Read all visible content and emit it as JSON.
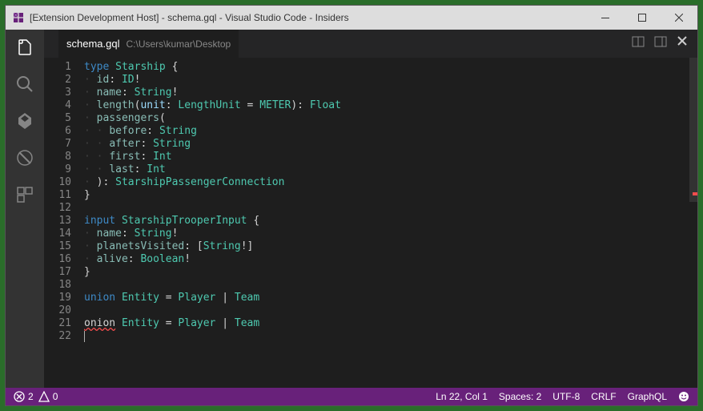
{
  "window": {
    "title": "[Extension Development Host] - schema.gql - Visual Studio Code - Insiders"
  },
  "tab": {
    "filename": "schema.gql",
    "filepath": "C:\\Users\\kumar\\Desktop"
  },
  "code": {
    "lines": [
      {
        "n": 1,
        "tokens": [
          {
            "t": "type",
            "c": "kw"
          },
          {
            "t": " "
          },
          {
            "t": "Starship",
            "c": "type"
          },
          {
            "t": " {",
            "c": "punct"
          }
        ]
      },
      {
        "n": 2,
        "indent": 1,
        "tokens": [
          {
            "t": "id",
            "c": "field"
          },
          {
            "t": ": ",
            "c": "punct"
          },
          {
            "t": "ID",
            "c": "type"
          },
          {
            "t": "!",
            "c": "punct"
          }
        ]
      },
      {
        "n": 3,
        "indent": 1,
        "tokens": [
          {
            "t": "name",
            "c": "field"
          },
          {
            "t": ": ",
            "c": "punct"
          },
          {
            "t": "String",
            "c": "type"
          },
          {
            "t": "!",
            "c": "punct"
          }
        ]
      },
      {
        "n": 4,
        "indent": 1,
        "tokens": [
          {
            "t": "length",
            "c": "field"
          },
          {
            "t": "(",
            "c": "punct"
          },
          {
            "t": "unit",
            "c": "param"
          },
          {
            "t": ": ",
            "c": "punct"
          },
          {
            "t": "LengthUnit",
            "c": "type"
          },
          {
            "t": " = ",
            "c": "punct"
          },
          {
            "t": "METER",
            "c": "type"
          },
          {
            "t": "): ",
            "c": "punct"
          },
          {
            "t": "Float",
            "c": "type"
          }
        ]
      },
      {
        "n": 5,
        "indent": 1,
        "tokens": [
          {
            "t": "passengers",
            "c": "field"
          },
          {
            "t": "(",
            "c": "punct"
          }
        ]
      },
      {
        "n": 6,
        "indent": 2,
        "tokens": [
          {
            "t": "before",
            "c": "field"
          },
          {
            "t": ": ",
            "c": "punct"
          },
          {
            "t": "String",
            "c": "type"
          }
        ]
      },
      {
        "n": 7,
        "indent": 2,
        "tokens": [
          {
            "t": "after",
            "c": "field"
          },
          {
            "t": ": ",
            "c": "punct"
          },
          {
            "t": "String",
            "c": "type"
          }
        ]
      },
      {
        "n": 8,
        "indent": 2,
        "tokens": [
          {
            "t": "first",
            "c": "field"
          },
          {
            "t": ": ",
            "c": "punct"
          },
          {
            "t": "Int",
            "c": "type"
          }
        ]
      },
      {
        "n": 9,
        "indent": 2,
        "tokens": [
          {
            "t": "last",
            "c": "field"
          },
          {
            "t": ": ",
            "c": "punct"
          },
          {
            "t": "Int",
            "c": "type"
          }
        ]
      },
      {
        "n": 10,
        "indent": 1,
        "tokens": [
          {
            "t": "): ",
            "c": "punct"
          },
          {
            "t": "StarshipPassengerConnection",
            "c": "type"
          }
        ]
      },
      {
        "n": 11,
        "tokens": [
          {
            "t": "}",
            "c": "punct"
          }
        ]
      },
      {
        "n": 12,
        "tokens": []
      },
      {
        "n": 13,
        "tokens": [
          {
            "t": "input",
            "c": "kw"
          },
          {
            "t": " "
          },
          {
            "t": "StarshipTrooperInput",
            "c": "type"
          },
          {
            "t": " {",
            "c": "punct"
          }
        ]
      },
      {
        "n": 14,
        "indent": 1,
        "tokens": [
          {
            "t": "name",
            "c": "field"
          },
          {
            "t": ": ",
            "c": "punct"
          },
          {
            "t": "String",
            "c": "type"
          },
          {
            "t": "!",
            "c": "punct"
          }
        ]
      },
      {
        "n": 15,
        "indent": 1,
        "tokens": [
          {
            "t": "planetsVisited",
            "c": "field"
          },
          {
            "t": ": [",
            "c": "punct"
          },
          {
            "t": "String",
            "c": "type"
          },
          {
            "t": "!]",
            "c": "punct"
          }
        ]
      },
      {
        "n": 16,
        "indent": 1,
        "tokens": [
          {
            "t": "alive",
            "c": "field"
          },
          {
            "t": ": ",
            "c": "punct"
          },
          {
            "t": "Boolean",
            "c": "type"
          },
          {
            "t": "!",
            "c": "punct"
          }
        ]
      },
      {
        "n": 17,
        "tokens": [
          {
            "t": "}",
            "c": "punct"
          }
        ]
      },
      {
        "n": 18,
        "tokens": []
      },
      {
        "n": 19,
        "tokens": [
          {
            "t": "union",
            "c": "kw"
          },
          {
            "t": " "
          },
          {
            "t": "Entity",
            "c": "type"
          },
          {
            "t": " = ",
            "c": "punct"
          },
          {
            "t": "Player",
            "c": "type"
          },
          {
            "t": " | ",
            "c": "punct"
          },
          {
            "t": "Team",
            "c": "type"
          }
        ]
      },
      {
        "n": 20,
        "tokens": []
      },
      {
        "n": 21,
        "tokens": [
          {
            "t": "onion",
            "c": "error"
          },
          {
            "t": " "
          },
          {
            "t": "Entity",
            "c": "type"
          },
          {
            "t": " = ",
            "c": "punct"
          },
          {
            "t": "Player",
            "c": "type"
          },
          {
            "t": " | ",
            "c": "punct"
          },
          {
            "t": "Team",
            "c": "type"
          }
        ]
      },
      {
        "n": 22,
        "cursor": true,
        "tokens": []
      }
    ]
  },
  "status": {
    "errors": "2",
    "warnings": "0",
    "position": "Ln 22, Col 1",
    "spaces": "Spaces: 2",
    "encoding": "UTF-8",
    "eol": "CRLF",
    "language": "GraphQL"
  }
}
